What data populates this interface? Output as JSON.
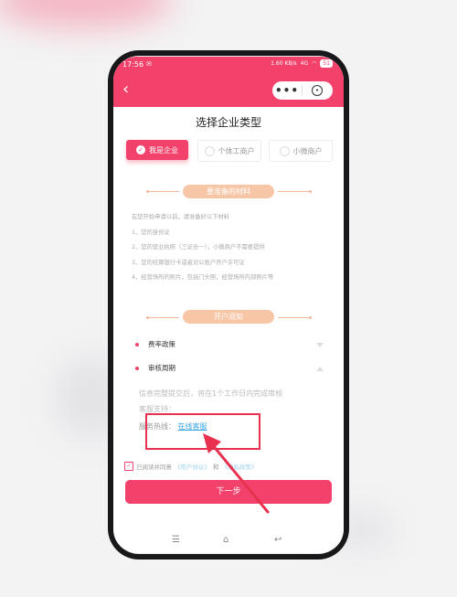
{
  "status_bar": {
    "time": "17:56",
    "notify": "✉",
    "net": "1.60 KB/s",
    "signal": "4G",
    "battery": "51"
  },
  "nav": {
    "back_glyph": "‹",
    "more_glyph": "•••",
    "close_glyph": "⊙"
  },
  "page": {
    "title": "选择企业类型"
  },
  "types": [
    {
      "label": "我是企业",
      "selected": true
    },
    {
      "label": "个体工商户",
      "selected": false
    },
    {
      "label": "小微商户",
      "selected": false
    }
  ],
  "materials": {
    "title": "要准备的材料",
    "items": [
      "在您开始申请以前，请准备好以下材料",
      "1、您的身份证",
      "2、您的营业执照（三证合一），小微商户不需要提供",
      "3、您的结算银行卡或者对公账户开户许可证",
      "4、经营场所的照片，包括门头照，经营场所内部照片等"
    ]
  },
  "notice": {
    "title": "开户须知",
    "rate_policy": "费率政策",
    "review_period": "审核周期",
    "review_text": "信息完整提交后，将在1个工作日内完成审核",
    "support_label": "客服支持：",
    "hotline_label": "服务热线：",
    "hotline_link": "在线客服"
  },
  "agreement": {
    "text": "已阅读并同意",
    "link1": "《用户协议》",
    "and": "和",
    "link2": "《隐私政策》"
  },
  "next_button": "下一步",
  "bottom_nav": {
    "menu": "☰",
    "home": "⌂",
    "back": "↩"
  },
  "colors": {
    "brand": "#f2426b",
    "accent_pill": "#f7c6a6",
    "highlight": "#e8304f"
  }
}
